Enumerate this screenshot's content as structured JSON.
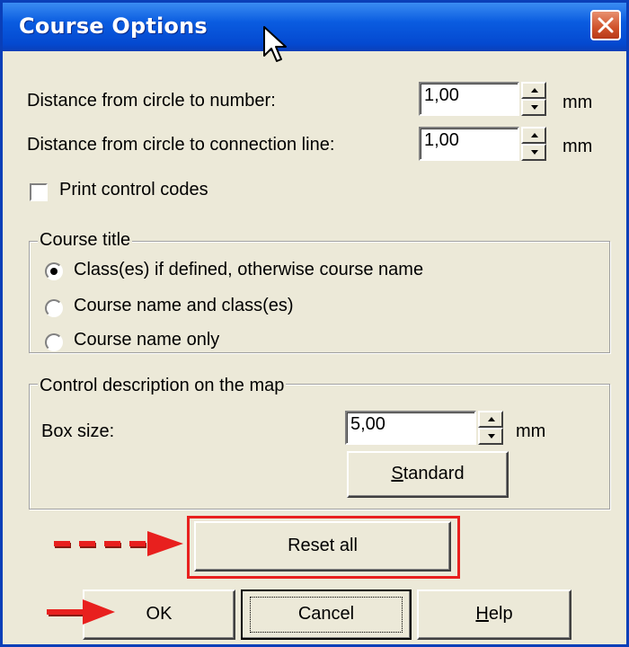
{
  "dialog": {
    "title": "Course Options"
  },
  "fields": {
    "distance_number": {
      "label": "Distance from circle to number:",
      "value": "1,00",
      "unit": "mm"
    },
    "distance_line": {
      "label": "Distance from circle to connection line:",
      "value": "1,00",
      "unit": "mm"
    },
    "print_codes": {
      "label": "Print control codes",
      "checked": false
    }
  },
  "course_title": {
    "legend": "Course title",
    "options": [
      {
        "label": "Class(es) if defined, otherwise course name",
        "selected": true
      },
      {
        "label": "Course name and class(es)",
        "selected": false
      },
      {
        "label": "Course name only",
        "selected": false
      }
    ]
  },
  "control_description": {
    "legend": "Control description on the map",
    "box_size": {
      "label": "Box size:",
      "value": "5,00",
      "unit": "mm"
    },
    "standard_button": {
      "accel": "S",
      "rest": "tandard"
    }
  },
  "buttons": {
    "reset_all": "Reset all",
    "ok": "OK",
    "cancel": "Cancel",
    "help": {
      "accel": "H",
      "rest": "elp"
    }
  },
  "icons": {
    "close": "close-icon",
    "cursor": "mouse-cursor-icon",
    "annotation_arrow_dashed": "dashed-red-arrow-icon",
    "annotation_arrow_solid": "red-arrow-icon"
  },
  "colors": {
    "titlebar": "#0a5ce0",
    "dialog_bg": "#ece9d8",
    "annotation": "#e8201e"
  }
}
